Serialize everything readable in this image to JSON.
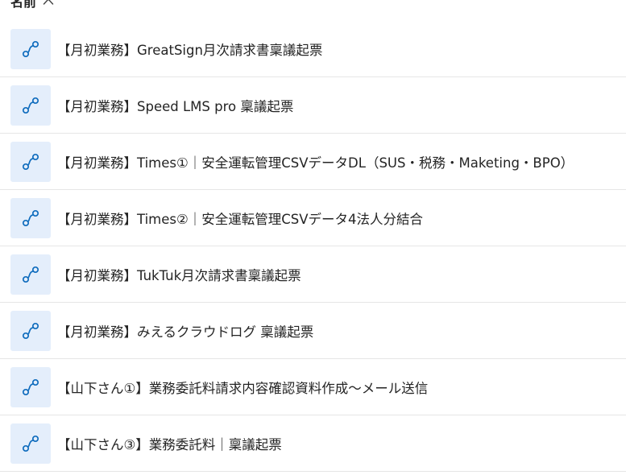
{
  "header": {
    "column_label": "名前",
    "sort_icon": "chevron-up-icon"
  },
  "accent_color": "#0f6cbd",
  "rows": [
    {
      "name": "【月初業務】GreatSign月次請求書稟議起票",
      "icon": "flow-connector-icon"
    },
    {
      "name": "【月初業務】Speed LMS pro 稟議起票",
      "icon": "flow-connector-icon"
    },
    {
      "name": "【月初業務】Times①｜安全運転管理CSVデータDL（SUS・税務・Maketing・BPO）",
      "icon": "flow-connector-icon"
    },
    {
      "name": "【月初業務】Times②｜安全運転管理CSVデータ4法人分結合",
      "icon": "flow-connector-icon"
    },
    {
      "name": "【月初業務】TukTuk月次請求書稟議起票",
      "icon": "flow-connector-icon"
    },
    {
      "name": "【月初業務】みえるクラウドログ 稟議起票",
      "icon": "flow-connector-icon"
    },
    {
      "name": "【山下さん①】業務委託料請求内容確認資料作成～メール送信",
      "icon": "flow-connector-icon"
    },
    {
      "name": "【山下さん③】業務委託料｜稟議起票",
      "icon": "flow-connector-icon"
    }
  ]
}
